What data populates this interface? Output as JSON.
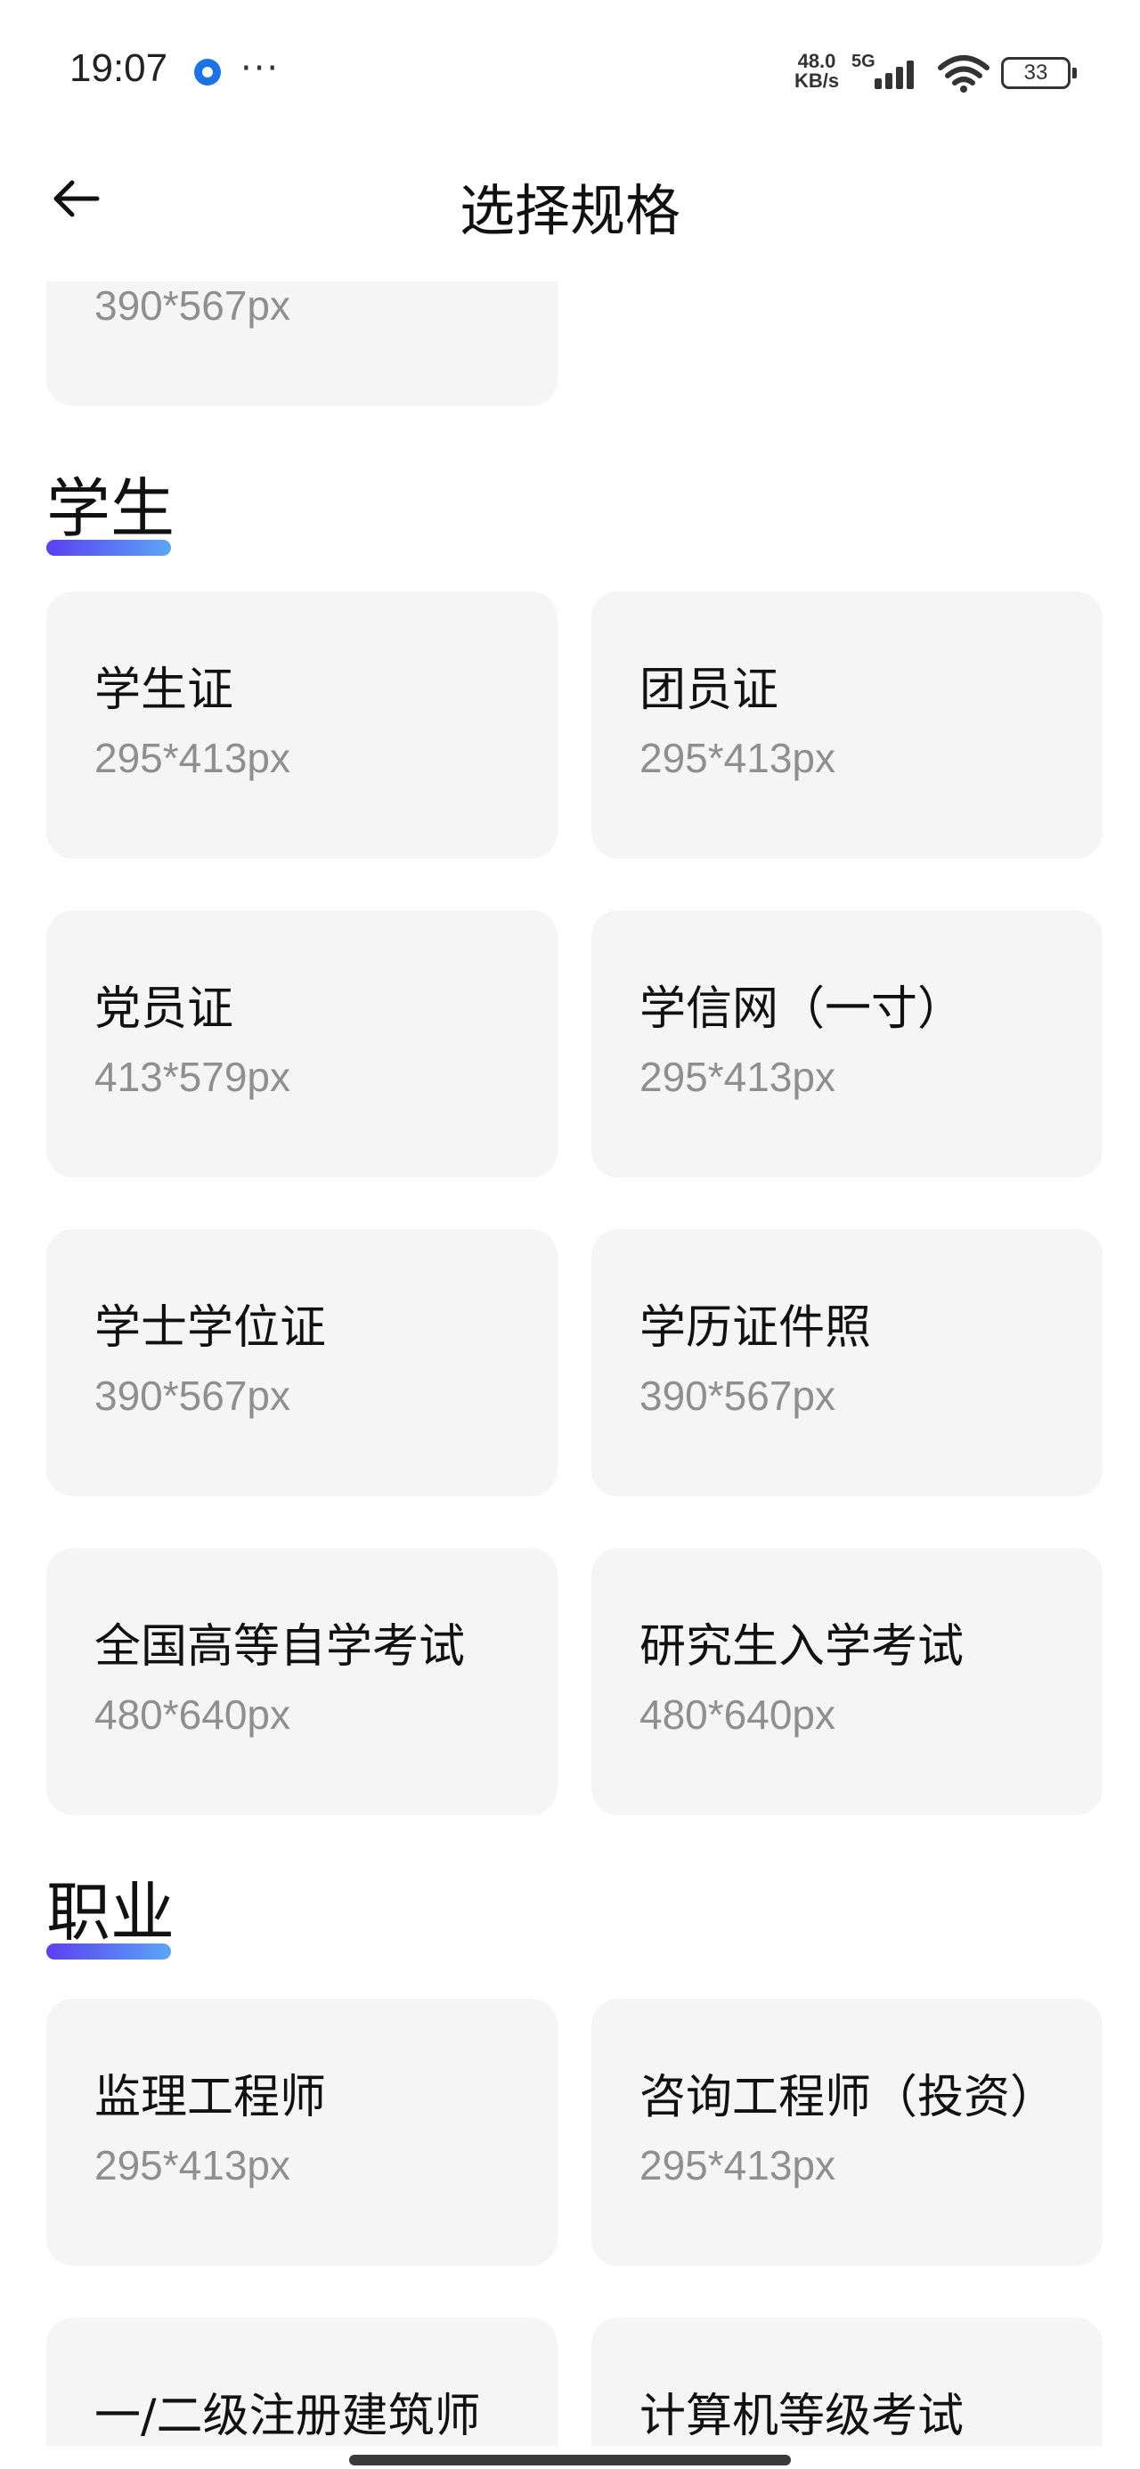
{
  "status": {
    "time": "19:07",
    "more": "···",
    "net_speed_value": "48.0",
    "net_speed_unit": "KB/s",
    "network": "5G",
    "battery": "33"
  },
  "nav": {
    "title": "选择规格"
  },
  "partial_card": {
    "size": "390*567px"
  },
  "sections": {
    "student": {
      "title": "学生",
      "cards": [
        {
          "title": "学生证",
          "size": "295*413px"
        },
        {
          "title": "团员证",
          "size": "295*413px"
        },
        {
          "title": "党员证",
          "size": "413*579px"
        },
        {
          "title": "学信网（一寸）",
          "size": "295*413px"
        },
        {
          "title": "学士学位证",
          "size": "390*567px"
        },
        {
          "title": "学历证件照",
          "size": "390*567px"
        },
        {
          "title": "全国高等自学考试",
          "size": "480*640px"
        },
        {
          "title": "研究生入学考试",
          "size": "480*640px"
        }
      ]
    },
    "career": {
      "title": "职业",
      "cards": [
        {
          "title": "监理工程师",
          "size": "295*413px"
        },
        {
          "title": "咨询工程师（投资）",
          "size": "295*413px"
        },
        {
          "title": "一/二级注册建筑师",
          "size": ""
        },
        {
          "title": "计算机等级考试",
          "size": ""
        }
      ]
    }
  }
}
